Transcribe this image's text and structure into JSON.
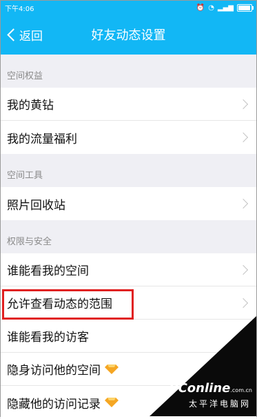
{
  "status_bar": {
    "time": "下午4:06"
  },
  "nav": {
    "back_label": "返回",
    "title": "好友动态设置"
  },
  "sections": [
    {
      "label": "空间权益",
      "items": [
        "我的黄钻",
        "我的流量福利"
      ]
    },
    {
      "label": "空间工具",
      "items": [
        "照片回收站"
      ]
    },
    {
      "label": "权限与安全",
      "items": [
        "谁能看我的空间",
        "允许查看动态的范围",
        "谁能看我的访客",
        "隐身访问他的空间",
        "隐藏他的访问记录"
      ]
    }
  ],
  "watermark": {
    "brand": "PConline",
    "domain": ".com.cn",
    "sub": "太平洋电脑网"
  },
  "colors": {
    "header": "#12b7f5",
    "highlight": "#e02020",
    "diamond": "#f5a623"
  }
}
